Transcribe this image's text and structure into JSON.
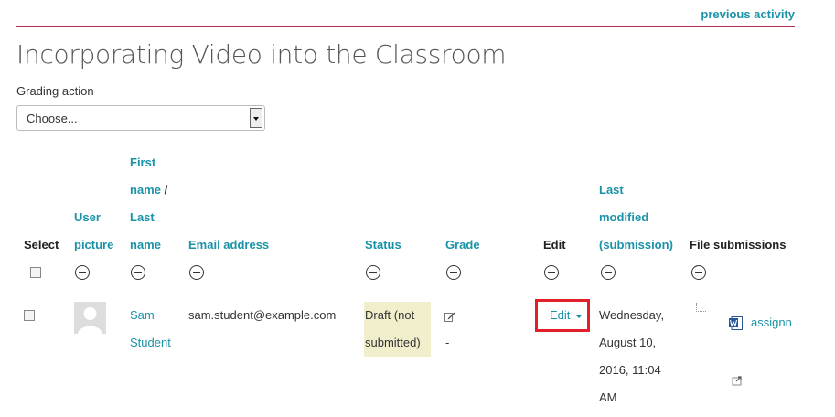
{
  "nav": {
    "previous_activity": "previous activity"
  },
  "page_title": "Incorporating Video into the Classroom",
  "grading_action": {
    "label": "Grading action",
    "selected": "Choose..."
  },
  "table": {
    "headers": {
      "select": "Select",
      "user_picture_1": "User",
      "user_picture_2": "picture",
      "first_name_1": "First",
      "first_name_2": "name",
      "first_name_sep": " /",
      "last_name_1": "Last",
      "last_name_2": "name",
      "email": "Email address",
      "status": "Status",
      "grade": "Grade",
      "edit": "Edit",
      "last_modified_1": "Last",
      "last_modified_2": "modified",
      "last_modified_3": "(submission)",
      "file_submissions": "File submissions"
    },
    "rows": [
      {
        "first_name": "Sam",
        "last_name": "Student",
        "email": "sam.student@example.com",
        "status_1": "Draft (not",
        "status_2": "submitted)",
        "grade": "-",
        "edit_label": "Edit",
        "modified_1": "Wednesday,",
        "modified_2": "August 10,",
        "modified_3": "2016, 11:04",
        "modified_4": "AM",
        "file_name": "assignn"
      }
    ]
  },
  "colors": {
    "link": "#1a93a8",
    "rule": "#b42e4f",
    "highlight_box": "#e3202a",
    "status_bg": "#f1eecb"
  }
}
